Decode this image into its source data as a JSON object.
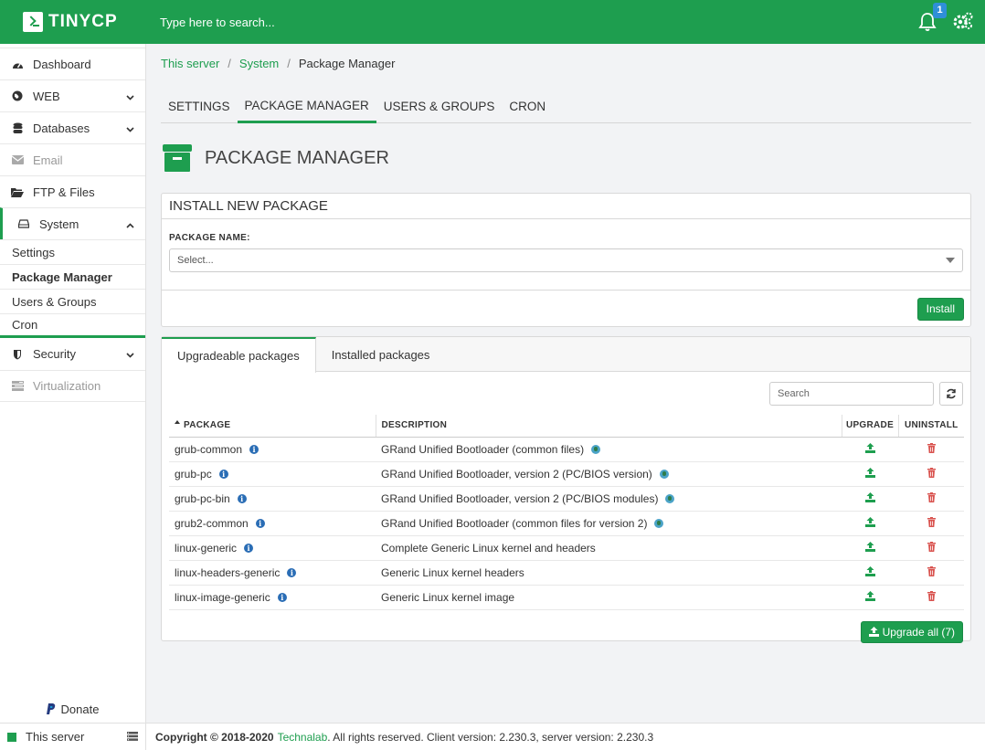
{
  "brand": {
    "name": "TINYCP"
  },
  "topbar": {
    "search_placeholder": "Type here to search...",
    "notification_count": "1"
  },
  "sidebar": {
    "items": [
      {
        "label": "Dashboard"
      },
      {
        "label": "WEB"
      },
      {
        "label": "Databases"
      },
      {
        "label": "Email"
      },
      {
        "label": "FTP & Files"
      },
      {
        "label": "System"
      },
      {
        "label": "Security"
      },
      {
        "label": "Virtualization"
      }
    ],
    "system_sub": [
      "Settings",
      "Package Manager",
      "Users & Groups",
      "Cron"
    ],
    "donate": "Donate",
    "server": "This server"
  },
  "breadcrumb": {
    "root": "This server",
    "mid": "System",
    "current": "Package Manager"
  },
  "tabs": [
    "SETTINGS",
    "PACKAGE MANAGER",
    "USERS & GROUPS",
    "CRON"
  ],
  "page": {
    "title": "PACKAGE MANAGER"
  },
  "install": {
    "title": "INSTALL NEW PACKAGE",
    "field_label": "PACKAGE NAME:",
    "select_placeholder": "Select...",
    "button": "Install"
  },
  "packages": {
    "tabs": [
      "Upgradeable packages",
      "Installed packages"
    ],
    "search_placeholder": "Search",
    "headers": {
      "package": "PACKAGE",
      "description": "DESCRIPTION",
      "upgrade": "UPGRADE",
      "uninstall": "UNINSTALL"
    },
    "rows": [
      {
        "name": "grub-common",
        "desc": "GRand Unified Bootloader (common files)",
        "web": true
      },
      {
        "name": "grub-pc",
        "desc": "GRand Unified Bootloader, version 2 (PC/BIOS version)",
        "web": true
      },
      {
        "name": "grub-pc-bin",
        "desc": "GRand Unified Bootloader, version 2 (PC/BIOS modules)",
        "web": true
      },
      {
        "name": "grub2-common",
        "desc": "GRand Unified Bootloader (common files for version 2)",
        "web": true
      },
      {
        "name": "linux-generic",
        "desc": "Complete Generic Linux kernel and headers",
        "web": false
      },
      {
        "name": "linux-headers-generic",
        "desc": "Generic Linux kernel headers",
        "web": false
      },
      {
        "name": "linux-image-generic",
        "desc": "Generic Linux kernel image",
        "web": false
      }
    ],
    "upgrade_all": "Upgrade all (7)"
  },
  "footer": {
    "copyright": "Copyright © 2018-2020",
    "company": "Technalab",
    "rest": ". All rights reserved. Client version: 2.230.3, server version: 2.230.3"
  },
  "colors": {
    "accent": "#1e9e4f",
    "danger": "#d9534f",
    "info": "#2a6db5"
  }
}
